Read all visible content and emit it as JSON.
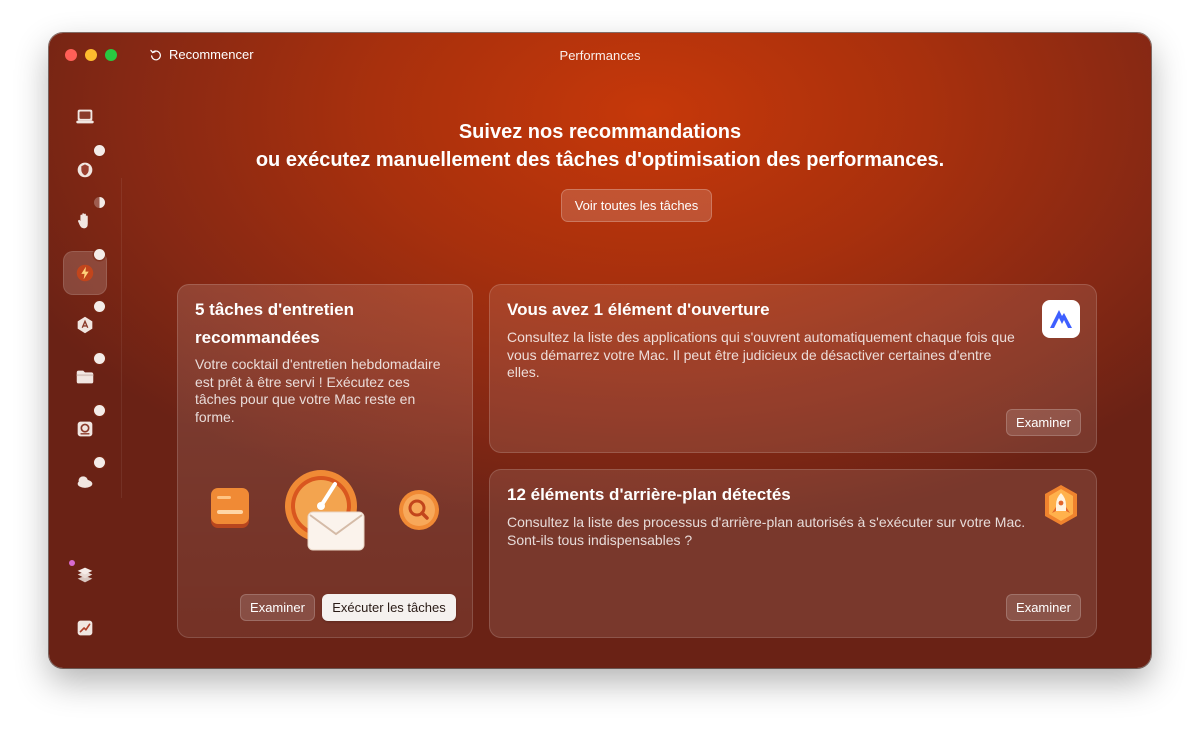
{
  "window": {
    "title": "Performances"
  },
  "toolbar": {
    "restart_label": "Recommencer"
  },
  "sidebar": {
    "items": [
      {
        "id": "system",
        "icon": "monitor-icon",
        "badge": false
      },
      {
        "id": "protection",
        "icon": "shield-icon",
        "badge": true
      },
      {
        "id": "privacy",
        "icon": "hand-icon",
        "badge": true
      },
      {
        "id": "performance",
        "icon": "lightning-icon",
        "badge": true,
        "active": true
      },
      {
        "id": "applications",
        "icon": "apps-icon",
        "badge": true
      },
      {
        "id": "files",
        "icon": "folder-icon",
        "badge": true
      },
      {
        "id": "space-lens",
        "icon": "disk-icon",
        "badge": true
      },
      {
        "id": "cloud",
        "icon": "cloud-icon",
        "badge": true
      }
    ],
    "bottom_items": [
      {
        "id": "assistant",
        "icon": "layers-icon"
      },
      {
        "id": "menu",
        "icon": "chart-icon"
      }
    ]
  },
  "hero": {
    "line1": "Suivez nos recommandations",
    "line2": "ou exécutez manuellement des tâches d'optimisation des performances.",
    "button_label": "Voir toutes les tâches"
  },
  "maintenance_card": {
    "title": "5 tâches d'entretien recommandées",
    "description": "Votre cocktail d'entretien hebdomadaire est prêt à être servi ! Exécutez ces tâches pour que votre Mac reste en forme.",
    "examine_label": "Examiner",
    "run_label": "Exécuter les tâches"
  },
  "login_items_card": {
    "title": "Vous avez 1 élément d'ouverture",
    "description": "Consultez la liste des applications qui s'ouvrent automatiquement chaque fois que vous démarrez votre Mac. Il peut être judicieux de désactiver certaines d'entre elles.",
    "examine_label": "Examiner",
    "icon": "nordvpn-icon"
  },
  "background_items_card": {
    "title": "12 éléments d'arrière-plan détectés",
    "description": "Consultez la liste des processus d'arrière-plan autorisés à s'exécuter sur votre Mac. Sont-ils tous indispensables ?",
    "examine_label": "Examiner",
    "icon": "rocket-icon"
  },
  "colors": {
    "accent": "#c6380a",
    "background_dark": "#6a2215",
    "run_button": "#f5f1ef"
  }
}
